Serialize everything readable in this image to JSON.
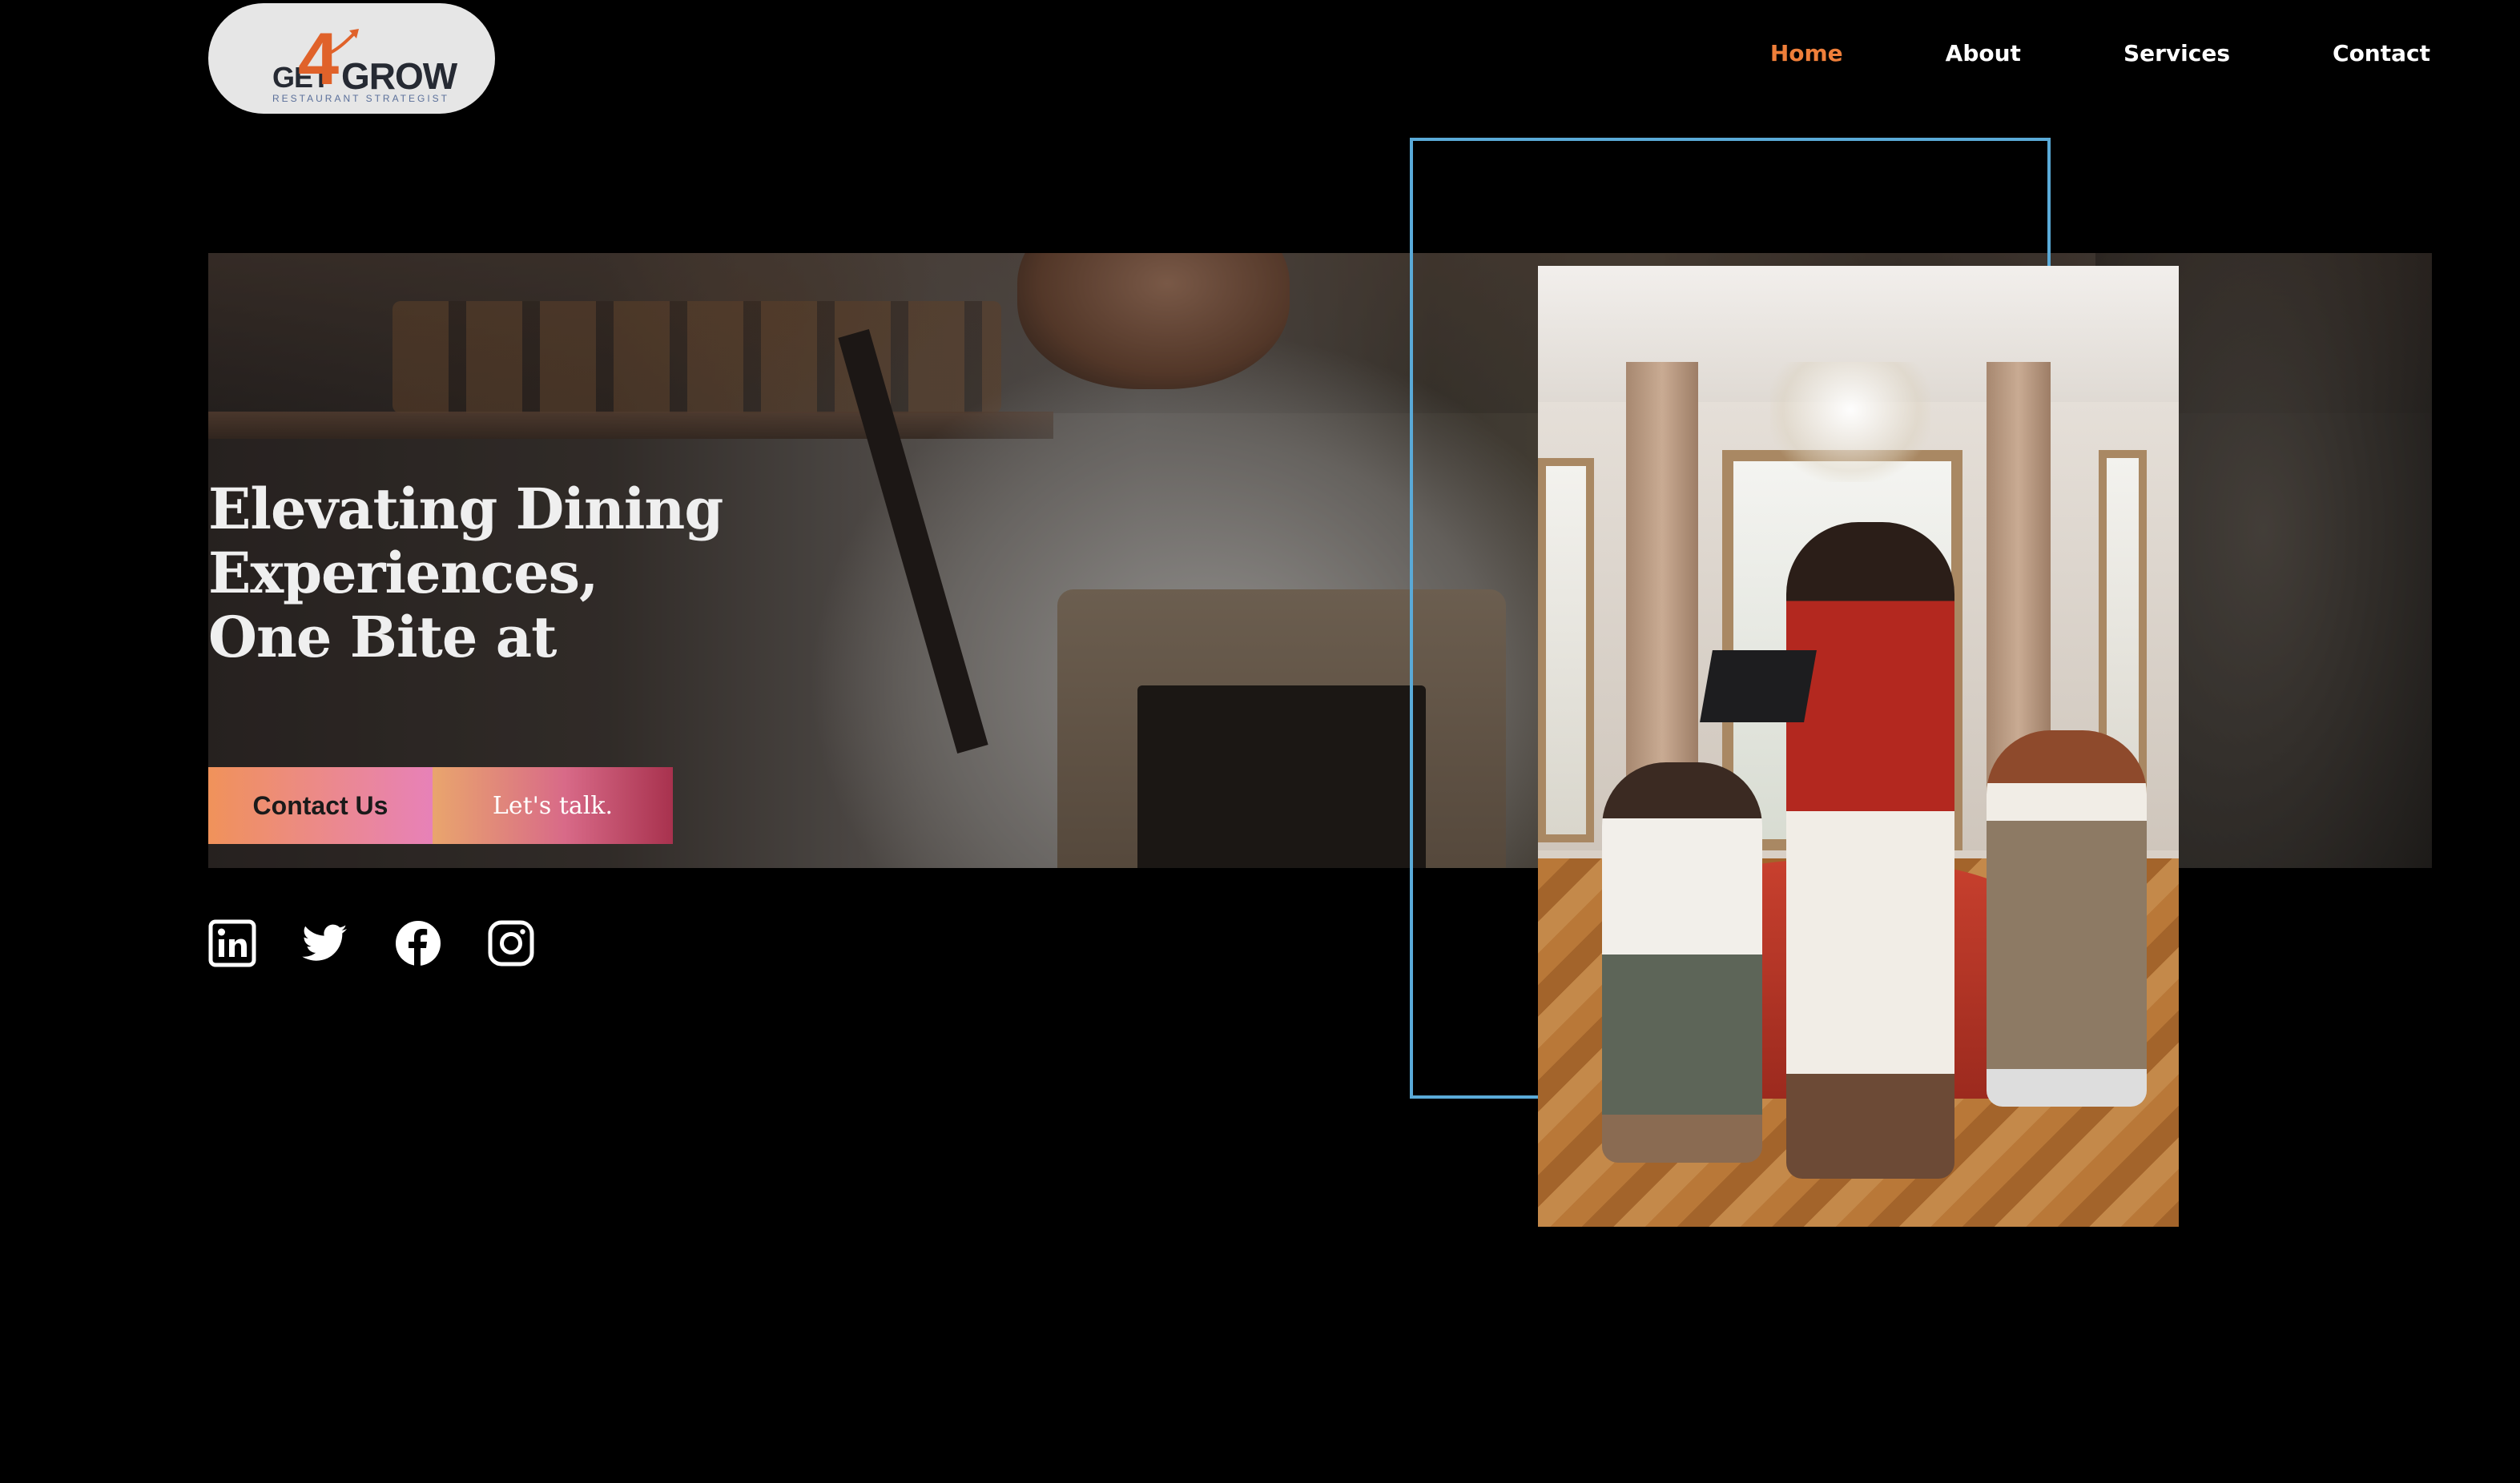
{
  "header": {
    "logo": {
      "get": "GET",
      "four": "4",
      "grow": "GROW",
      "tagline": "RESTAURANT STRATEGIST"
    },
    "nav": [
      {
        "label": "Home",
        "active": true
      },
      {
        "label": "About",
        "active": false
      },
      {
        "label": "Services",
        "active": false
      },
      {
        "label": "Contact",
        "active": false
      }
    ]
  },
  "hero": {
    "title_line1": "Elevating Dining Experiences,",
    "title_line2": "One Bite at",
    "contact_button": "Contact Us",
    "talk_button": "Let's talk."
  },
  "social": [
    "linkedin-icon",
    "twitter-icon",
    "facebook-icon",
    "instagram-icon"
  ],
  "colors": {
    "background": "#000000",
    "nav_active": "#ef7f3a",
    "nav_text": "#ffffff",
    "frame_border": "#5aaad8",
    "contact_gradient": [
      "#f0925a",
      "#e781b8"
    ],
    "talk_gradient": [
      "#e9a56d",
      "#a8324e"
    ]
  }
}
